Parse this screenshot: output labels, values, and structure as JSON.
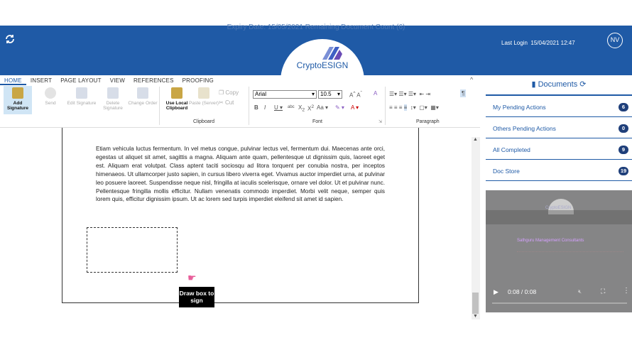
{
  "header": {
    "expiry_text": "Expiry Date: 15/05/2021  Remaining Document Count (6)",
    "logo_text": "CryptoESIGN",
    "last_login_label": "Last Login",
    "last_login_value": "15/04/2021 12:47",
    "avatar_initials": "NV",
    "brand_color": "#1f5aa6"
  },
  "ribbon": {
    "tabs": [
      "HOME",
      "INSERT",
      "PAGE LAYOUT",
      "VIEW",
      "REFERENCES",
      "PROOFING"
    ],
    "buttons": {
      "add_signature": "Add Signature",
      "send": "Send",
      "edit_signature": "Edit Signature",
      "delete_signature": "Delete Signature",
      "change_order": "Change Order",
      "use_local_clipboard": "Use Local Clipboard",
      "paste_server": "Paste (Server)",
      "copy": "Copy",
      "cut": "Cut"
    },
    "groups": {
      "clipboard": "Clipboard",
      "font": "Font",
      "paragraph": "Paragraph"
    },
    "font_name": "Arial",
    "font_size": "10.5"
  },
  "document": {
    "paragraph": "Etiam vehicula luctus fermentum. In vel metus congue, pulvinar lectus vel, fermentum dui. Maecenas ante orci, egestas ut aliquet sit amet, sagittis a magna. Aliquam ante quam, pellentesque ut dignissim quis, laoreet eget est. Aliquam erat volutpat. Class aptent taciti sociosqu ad litora torquent per conubia nostra, per inceptos himenaeos. Ut ullamcorper justo sapien, in cursus libero viverra eget. Vivamus auctor imperdiet urna, at pulvinar leo posuere laoreet. Suspendisse neque nisl, fringilla at iaculis scelerisque, ornare vel dolor. Ut et pulvinar nunc. Pellentesque fringilla mollis efficitur. Nullam venenatis commodo imperdiet. Morbi velit neque, semper quis lorem quis, efficitur dignissim ipsum. Ut ac lorem sed turpis imperdiet eleifend sit amet id sapien.",
    "tooltip": "Draw box to sign"
  },
  "panel": {
    "title": "Documents",
    "items": [
      {
        "label": "My Pending Actions",
        "count": "6"
      },
      {
        "label": "Others Pending Actions",
        "count": "0"
      },
      {
        "label": "All Completed",
        "count": "9"
      },
      {
        "label": "Doc Store",
        "count": "19"
      }
    ]
  },
  "video": {
    "time": "0:08 / 0:08",
    "thumb_title": "Sathguru Management Consultants",
    "thumb_logo": "CryptoESIGN"
  }
}
